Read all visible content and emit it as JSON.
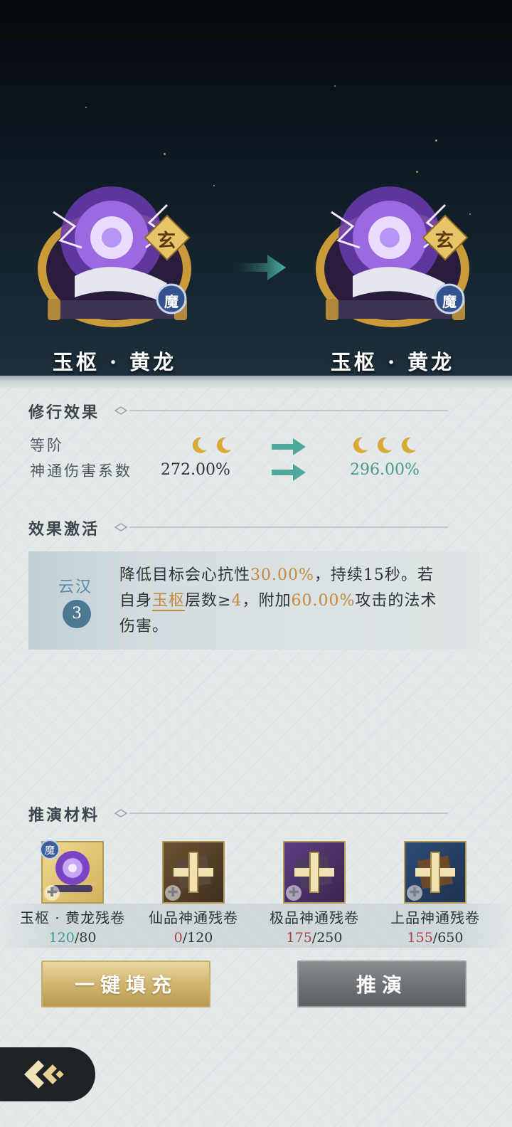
{
  "header": {
    "current_item": {
      "name": "玉枢 · 黄龙",
      "grade_badge": "玄",
      "type_badge": "魔"
    },
    "next_item": {
      "name": "玉枢 · 黄龙",
      "grade_badge": "玄",
      "type_badge": "魔"
    }
  },
  "cultivation": {
    "title": "修行效果",
    "rank_label": "等阶",
    "rank_current_moons": 2,
    "rank_next_moons": 3,
    "damage_label": "神通伤害系数",
    "damage_current": "272.00%",
    "damage_next": "296.00%"
  },
  "activation": {
    "title": "效果激活",
    "tier_label": "云汉",
    "tier_number": "3",
    "text_parts": {
      "p1": "降低目标会心抗性",
      "v1": "30.00%",
      "p2": "，持续15秒。若自身",
      "v2": "玉枢",
      "p3": "层数≥",
      "v3": "4",
      "p4": "，附加",
      "v4": "60.00%",
      "p5": "攻击的法术伤害。"
    }
  },
  "materials": {
    "title": "推演材料",
    "items": [
      {
        "name": "玉枢 · 黄龙残卷",
        "have": "120",
        "need": "/80",
        "enough": true,
        "badge": "魔"
      },
      {
        "name": "仙品神通残卷",
        "have": "0",
        "need": "/120",
        "enough": false
      },
      {
        "name": "极品神通残卷",
        "have": "175",
        "need": "/250",
        "enough": false
      },
      {
        "name": "上品神通残卷",
        "have": "155",
        "need": "/650",
        "enough": false
      }
    ]
  },
  "buttons": {
    "fill_label": "一键填充",
    "deduce_label": "推演"
  },
  "colors": {
    "accent_teal": "#4c9890",
    "highlight_gold": "#c58a3c",
    "insufficient_red": "#b04040"
  }
}
